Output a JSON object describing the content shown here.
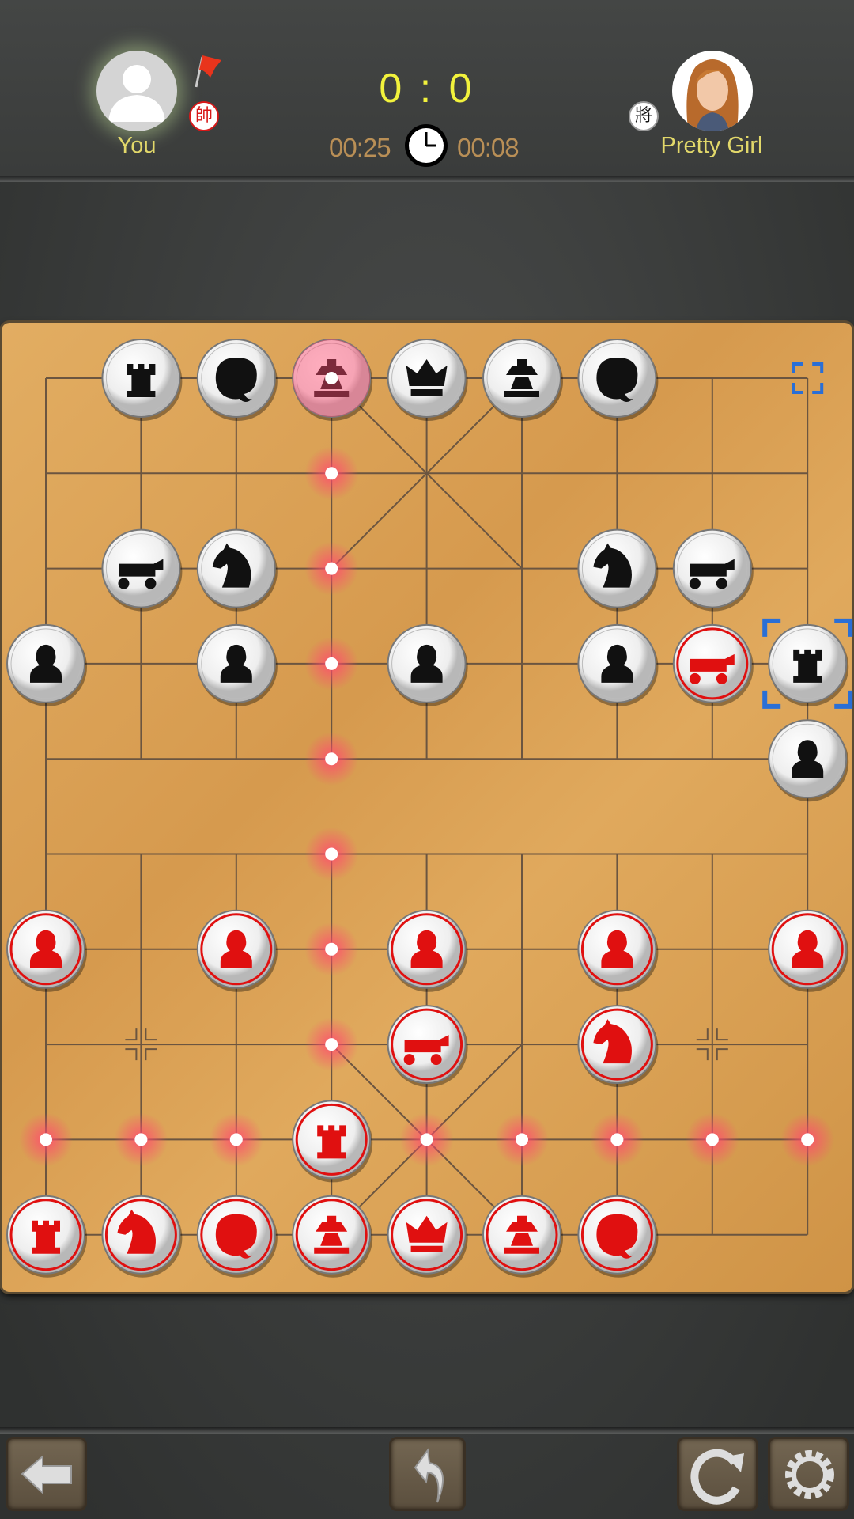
{
  "header": {
    "player_you": {
      "name": "You",
      "side_badge": "帥",
      "side_color": "#d81818",
      "flag": "red-flag-icon"
    },
    "player_opponent": {
      "name": "Pretty Girl",
      "side_badge": "將",
      "side_color": "#111111"
    },
    "score": {
      "you": "0",
      "separator": ":",
      "opponent": "0"
    },
    "timer_you": "00:25",
    "timer_opponent": "00:08",
    "clock_icon": "clock-icon"
  },
  "board": {
    "files": 9,
    "ranks": 10,
    "colors": {
      "red": "#e01010",
      "black": "#111111",
      "move_dot": "#ff5a78",
      "selection": "#2a6fd6"
    },
    "pieces": [
      {
        "side": "black",
        "type": "rook",
        "col": 1,
        "row": 0
      },
      {
        "side": "black",
        "type": "elephant",
        "col": 2,
        "row": 0
      },
      {
        "side": "black",
        "type": "advisor",
        "col": 3,
        "row": 0,
        "capture_target": true
      },
      {
        "side": "black",
        "type": "king",
        "col": 4,
        "row": 0
      },
      {
        "side": "black",
        "type": "advisor",
        "col": 5,
        "row": 0
      },
      {
        "side": "black",
        "type": "elephant",
        "col": 6,
        "row": 0
      },
      {
        "side": "black",
        "type": "cannon",
        "col": 1,
        "row": 2
      },
      {
        "side": "black",
        "type": "horse",
        "col": 2,
        "row": 2
      },
      {
        "side": "black",
        "type": "horse",
        "col": 6,
        "row": 2
      },
      {
        "side": "black",
        "type": "cannon",
        "col": 7,
        "row": 2
      },
      {
        "side": "black",
        "type": "pawn",
        "col": 0,
        "row": 3
      },
      {
        "side": "black",
        "type": "pawn",
        "col": 2,
        "row": 3
      },
      {
        "side": "black",
        "type": "pawn",
        "col": 4,
        "row": 3
      },
      {
        "side": "black",
        "type": "pawn",
        "col": 6,
        "row": 3
      },
      {
        "side": "red",
        "type": "cannon",
        "col": 7,
        "row": 3
      },
      {
        "side": "black",
        "type": "rook",
        "col": 8,
        "row": 3,
        "last_move": true
      },
      {
        "side": "black",
        "type": "pawn",
        "col": 8,
        "row": 4
      },
      {
        "side": "red",
        "type": "pawn",
        "col": 0,
        "row": 6
      },
      {
        "side": "red",
        "type": "pawn",
        "col": 2,
        "row": 6
      },
      {
        "side": "red",
        "type": "pawn",
        "col": 4,
        "row": 6
      },
      {
        "side": "red",
        "type": "pawn",
        "col": 6,
        "row": 6
      },
      {
        "side": "red",
        "type": "pawn",
        "col": 8,
        "row": 6
      },
      {
        "side": "red",
        "type": "cannon",
        "col": 4,
        "row": 7
      },
      {
        "side": "red",
        "type": "horse",
        "col": 6,
        "row": 7
      },
      {
        "side": "red",
        "type": "rook",
        "col": 3,
        "row": 8,
        "selected": true
      },
      {
        "side": "red",
        "type": "rook",
        "col": 0,
        "row": 9
      },
      {
        "side": "red",
        "type": "horse",
        "col": 1,
        "row": 9
      },
      {
        "side": "red",
        "type": "elephant",
        "col": 2,
        "row": 9
      },
      {
        "side": "red",
        "type": "advisor",
        "col": 3,
        "row": 9
      },
      {
        "side": "red",
        "type": "king",
        "col": 4,
        "row": 9
      },
      {
        "side": "red",
        "type": "advisor",
        "col": 5,
        "row": 9
      },
      {
        "side": "red",
        "type": "elephant",
        "col": 6,
        "row": 9
      }
    ],
    "legal_moves": [
      [
        3,
        1
      ],
      [
        3,
        2
      ],
      [
        3,
        3
      ],
      [
        3,
        4
      ],
      [
        3,
        5
      ],
      [
        3,
        6
      ],
      [
        3,
        7
      ],
      [
        0,
        8
      ],
      [
        1,
        8
      ],
      [
        2,
        8
      ],
      [
        4,
        8
      ],
      [
        5,
        8
      ],
      [
        6,
        8
      ],
      [
        7,
        8
      ],
      [
        8,
        8
      ]
    ],
    "last_move_from": [
      8,
      0
    ],
    "position_marks": [
      [
        1,
        7
      ],
      [
        7,
        7
      ]
    ]
  },
  "toolbar": {
    "back": "back-arrow-icon",
    "undo": "undo-icon",
    "restart": "restart-icon",
    "settings": "gear-icon"
  }
}
